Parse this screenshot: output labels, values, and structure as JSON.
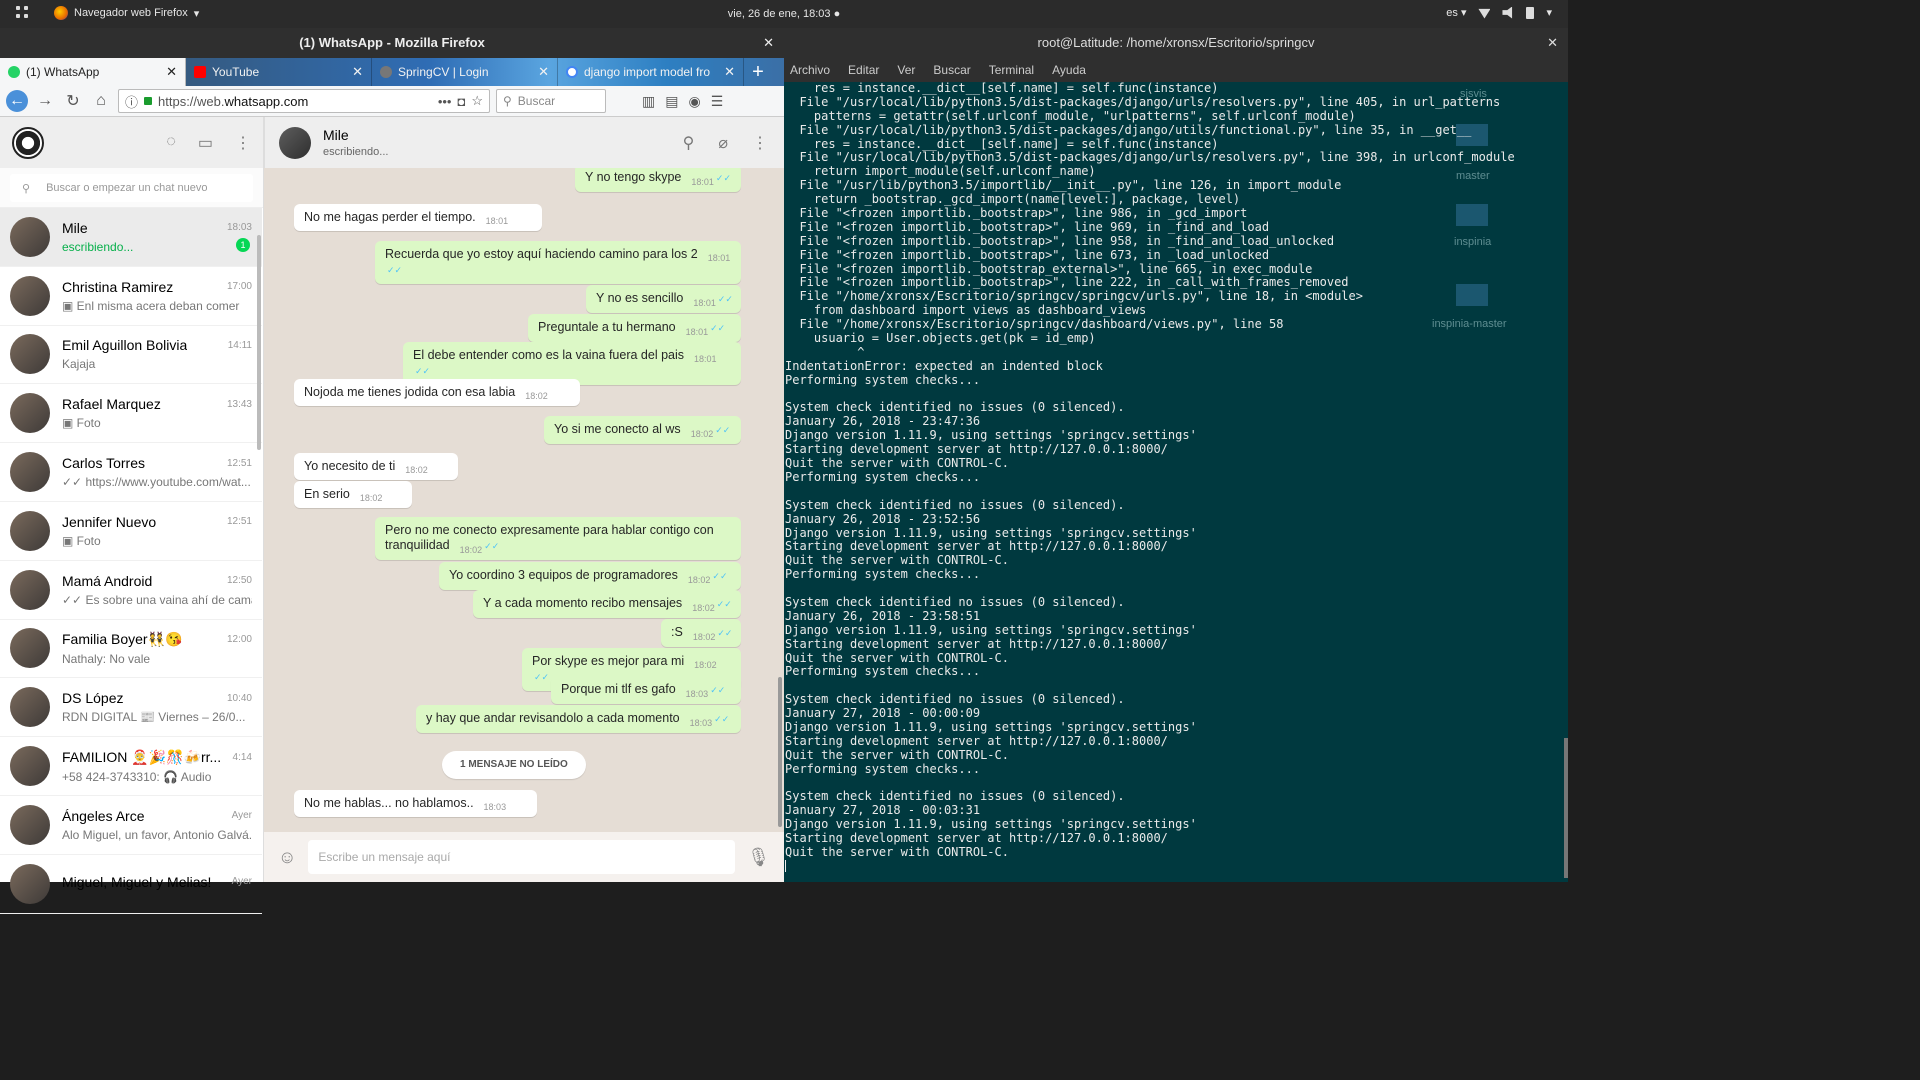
{
  "topbar": {
    "app_menu": "Navegador web Firefox",
    "clock": "vie, 26 de ene, 18:03 ●",
    "lang": "es ▾"
  },
  "firefox": {
    "window_title": "(1) WhatsApp - Mozilla Firefox",
    "tabs": [
      {
        "label": "(1) WhatsApp",
        "favicon": "whatsapp"
      },
      {
        "label": "YouTube",
        "favicon": "youtube"
      },
      {
        "label": "SpringCV | Login",
        "favicon": "springcv"
      },
      {
        "label": "django import model fro",
        "favicon": "google"
      }
    ],
    "url_prefix": "https://web.",
    "url_domain": "whatsapp.com",
    "search_placeholder": "Buscar"
  },
  "whatsapp": {
    "search_placeholder": "Buscar o empezar un chat nuevo",
    "chats": [
      {
        "name": "Mile",
        "time": "18:03",
        "preview": "escribiendo...",
        "unread": "1",
        "selected": true
      },
      {
        "name": "Christina Ramirez",
        "time": "17:00",
        "preview": "▣ Enl misma acera deban comer"
      },
      {
        "name": "Emil Aguillon Bolivia",
        "time": "14:11",
        "preview": "Kajaja"
      },
      {
        "name": "Rafael Marquez",
        "time": "13:43",
        "preview": "▣ Foto"
      },
      {
        "name": "Carlos Torres",
        "time": "12:51",
        "preview": "✓✓ https://www.youtube.com/wat..."
      },
      {
        "name": "Jennifer Nuevo",
        "time": "12:51",
        "preview": "▣ Foto"
      },
      {
        "name": "Mamá Android",
        "time": "12:50",
        "preview": "✓✓ Es sobre una vaina ahí de cama..."
      },
      {
        "name": "Familia Boyer👯😘",
        "time": "12:00",
        "preview": "Nathaly: No vale"
      },
      {
        "name": "DS López",
        "time": "10:40",
        "preview": "RDN DIGITAL 📰 Viernes – 26/0..."
      },
      {
        "name": "FAMILION 🤶🎉🎊🍻rr...",
        "time": "4:14",
        "preview": "+58 424-3743310: 🎧 Audio"
      },
      {
        "name": "Ángeles Arce",
        "time": "Ayer",
        "preview": "Alo Miguel, un favor, Antonio Galvá..."
      },
      {
        "name": "Miguel, Miguel y Melias!",
        "time": "Ayer",
        "preview": ""
      }
    ],
    "conversation": {
      "contact": "Mile",
      "status": "escribiendo...",
      "messages": [
        {
          "dir": "out",
          "text": "Y no tengo skype",
          "time": "18:01"
        },
        {
          "dir": "in",
          "text": "No me hagas perder el tiempo.",
          "time": "18:01"
        },
        {
          "dir": "out",
          "text": "Recuerda que yo estoy aquí haciendo camino para los 2",
          "time": "18:01"
        },
        {
          "dir": "out",
          "text": "Y no es sencillo",
          "time": "18:01"
        },
        {
          "dir": "out",
          "text": "Preguntale a tu hermano",
          "time": "18:01"
        },
        {
          "dir": "out",
          "text": "El debe entender como es la vaina fuera del pais",
          "time": "18:01"
        },
        {
          "dir": "in",
          "text": "Nojoda me tienes jodida con esa labia",
          "time": "18:02"
        },
        {
          "dir": "out",
          "text": "Yo si me conecto al ws",
          "time": "18:02"
        },
        {
          "dir": "in",
          "text": "Yo necesito de ti",
          "time": "18:02"
        },
        {
          "dir": "in",
          "text": "En serio",
          "time": "18:02"
        },
        {
          "dir": "out",
          "text": "Pero no me conecto expresamente para hablar contigo con tranquilidad",
          "time": "18:02"
        },
        {
          "dir": "out",
          "text": "Yo coordino 3 equipos de programadores",
          "time": "18:02"
        },
        {
          "dir": "out",
          "text": "Y a cada momento recibo mensajes",
          "time": "18:02"
        },
        {
          "dir": "out",
          "text": ":S",
          "time": "18:02"
        },
        {
          "dir": "out",
          "text": "Por skype es mejor para mi",
          "time": "18:02"
        },
        {
          "dir": "out",
          "text": "Porque mi tlf es gafo",
          "time": "18:03"
        },
        {
          "dir": "out",
          "text": "y hay que andar revisandolo a cada momento",
          "time": "18:03"
        },
        {
          "dir": "in",
          "text": "No me hablas... no hablamos..",
          "time": "18:03"
        }
      ],
      "unread_label": "1 MENSAJE NO LEÍDO",
      "compose_placeholder": "Escribe un mensaje aquí"
    }
  },
  "terminal": {
    "title": "root@Latitude: /home/xronsx/Escritorio/springcv",
    "menu": [
      "Archivo",
      "Editar",
      "Ver",
      "Buscar",
      "Terminal",
      "Ayuda"
    ],
    "background_labels": [
      "sisvis",
      "master",
      "inspinia",
      "inspinia-master"
    ],
    "lines": [
      "    res = instance.__dict__[self.name] = self.func(instance)",
      "  File \"/usr/local/lib/python3.5/dist-packages/django/urls/resolvers.py\", line 405, in url_patterns",
      "    patterns = getattr(self.urlconf_module, \"urlpatterns\", self.urlconf_module)",
      "  File \"/usr/local/lib/python3.5/dist-packages/django/utils/functional.py\", line 35, in __get__",
      "    res = instance.__dict__[self.name] = self.func(instance)",
      "  File \"/usr/local/lib/python3.5/dist-packages/django/urls/resolvers.py\", line 398, in urlconf_module",
      "    return import_module(self.urlconf_name)",
      "  File \"/usr/lib/python3.5/importlib/__init__.py\", line 126, in import_module",
      "    return _bootstrap._gcd_import(name[level:], package, level)",
      "  File \"<frozen importlib._bootstrap>\", line 986, in _gcd_import",
      "  File \"<frozen importlib._bootstrap>\", line 969, in _find_and_load",
      "  File \"<frozen importlib._bootstrap>\", line 958, in _find_and_load_unlocked",
      "  File \"<frozen importlib._bootstrap>\", line 673, in _load_unlocked",
      "  File \"<frozen importlib._bootstrap_external>\", line 665, in exec_module",
      "  File \"<frozen importlib._bootstrap>\", line 222, in _call_with_frames_removed",
      "  File \"/home/xronsx/Escritorio/springcv/springcv/urls.py\", line 18, in <module>",
      "    from dashboard import views as dashboard_views",
      "  File \"/home/xronsx/Escritorio/springcv/dashboard/views.py\", line 58",
      "    usuario = User.objects.get(pk = id_emp)",
      "          ^",
      "IndentationError: expected an indented block",
      "Performing system checks...",
      "",
      "System check identified no issues (0 silenced).",
      "January 26, 2018 - 23:47:36",
      "Django version 1.11.9, using settings 'springcv.settings'",
      "Starting development server at http://127.0.0.1:8000/",
      "Quit the server with CONTROL-C.",
      "Performing system checks...",
      "",
      "System check identified no issues (0 silenced).",
      "January 26, 2018 - 23:52:56",
      "Django version 1.11.9, using settings 'springcv.settings'",
      "Starting development server at http://127.0.0.1:8000/",
      "Quit the server with CONTROL-C.",
      "Performing system checks...",
      "",
      "System check identified no issues (0 silenced).",
      "January 26, 2018 - 23:58:51",
      "Django version 1.11.9, using settings 'springcv.settings'",
      "Starting development server at http://127.0.0.1:8000/",
      "Quit the server with CONTROL-C.",
      "Performing system checks...",
      "",
      "System check identified no issues (0 silenced).",
      "January 27, 2018 - 00:00:09",
      "Django version 1.11.9, using settings 'springcv.settings'",
      "Starting development server at http://127.0.0.1:8000/",
      "Quit the server with CONTROL-C.",
      "Performing system checks...",
      "",
      "System check identified no issues (0 silenced).",
      "January 27, 2018 - 00:03:31",
      "Django version 1.11.9, using settings 'springcv.settings'",
      "Starting development server at http://127.0.0.1:8000/",
      "Quit the server with CONTROL-C."
    ]
  }
}
